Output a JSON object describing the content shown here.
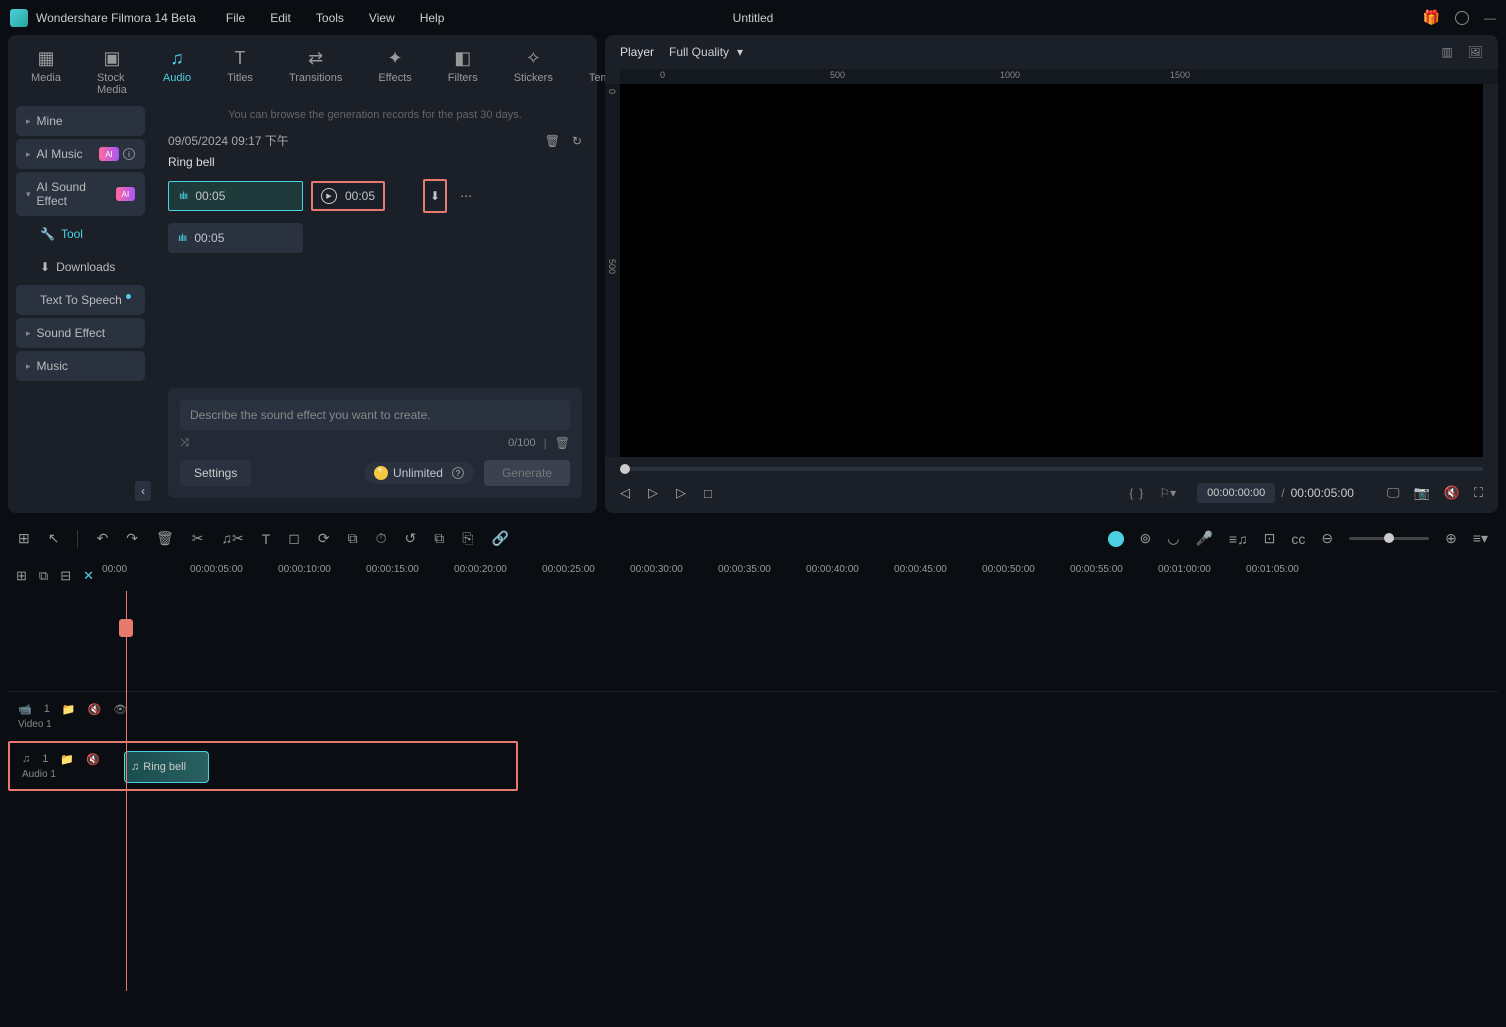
{
  "app": {
    "title": "Wondershare Filmora 14 Beta",
    "doc": "Untitled"
  },
  "menu": [
    "File",
    "Edit",
    "Tools",
    "View",
    "Help"
  ],
  "tabs": [
    {
      "label": "Media"
    },
    {
      "label": "Stock Media"
    },
    {
      "label": "Audio"
    },
    {
      "label": "Titles"
    },
    {
      "label": "Transitions"
    },
    {
      "label": "Effects"
    },
    {
      "label": "Filters"
    },
    {
      "label": "Stickers"
    },
    {
      "label": "Templates"
    }
  ],
  "sidebar": {
    "items": [
      {
        "label": "Mine"
      },
      {
        "label": "AI Music",
        "ai": true
      },
      {
        "label": "AI Sound Effect",
        "ai": true
      },
      {
        "label": "Tool"
      },
      {
        "label": "Downloads"
      },
      {
        "label": "Text To Speech"
      },
      {
        "label": "Sound Effect"
      },
      {
        "label": "Music"
      }
    ]
  },
  "content": {
    "hint": "You can browse the generation records for the past 30 days.",
    "timestamp": "09/05/2024 09:17 下午",
    "clip_title": "Ring bell",
    "clips": [
      {
        "dur": "00:05"
      },
      {
        "dur": "00:05"
      }
    ],
    "play_dur": "00:05"
  },
  "generate": {
    "placeholder": "Describe the sound effect you want to create.",
    "count": "0/100",
    "settings": "Settings",
    "unlimited": "Unlimited",
    "btn": "Generate"
  },
  "player": {
    "label": "Player",
    "quality": "Full Quality",
    "ruler_h": [
      "0",
      "500",
      "1000",
      "1500"
    ],
    "ruler_v": [
      "0",
      "500"
    ],
    "time_current": "00:00:00:00",
    "time_total": "00:00:05:00"
  },
  "timeline": {
    "ticks": [
      "00:00",
      "00:00:05:00",
      "00:00:10:00",
      "00:00:15:00",
      "00:00:20:00",
      "00:00:25:00",
      "00:00:30:00",
      "00:00:35:00",
      "00:00:40:00",
      "00:00:45:00",
      "00:00:50:00",
      "00:00:55:00",
      "00:01:00:00",
      "00:01:05:00"
    ],
    "tracks": {
      "video": {
        "num": "1",
        "label": "Video 1"
      },
      "audio": {
        "num": "1",
        "label": "Audio 1",
        "clip": "Ring bell"
      }
    }
  }
}
